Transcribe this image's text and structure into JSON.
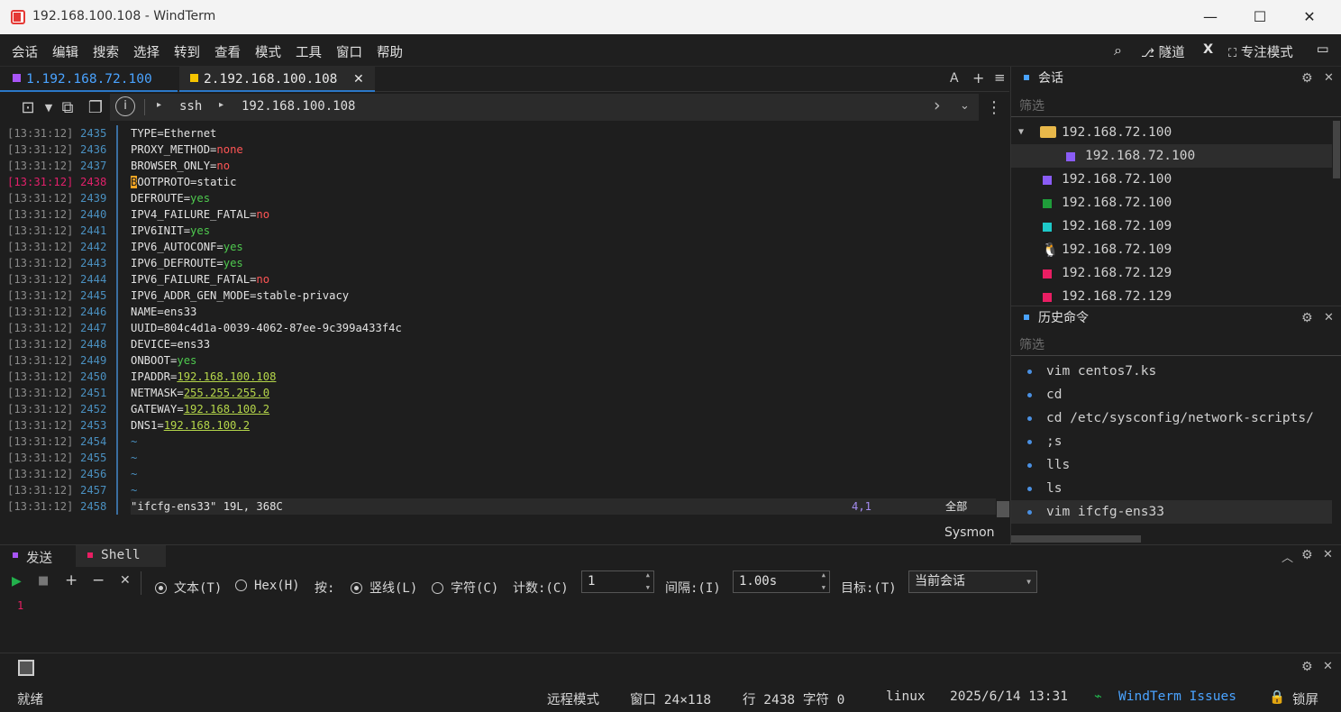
{
  "window": {
    "title": "192.168.100.108 - WindTerm"
  },
  "menu": [
    "会话",
    "编辑",
    "搜索",
    "选择",
    "转到",
    "查看",
    "模式",
    "工具",
    "窗口",
    "帮助"
  ],
  "menu_right": {
    "tunnel": "隧道",
    "x": "X",
    "focus": "专注模式"
  },
  "tabs": [
    {
      "label": "1.192.168.72.100",
      "color": "#a855f7",
      "active": false
    },
    {
      "label": "2.192.168.100.108",
      "color": "#f5c400",
      "active": true
    }
  ],
  "tab_actions": {
    "font": "A",
    "add": "+",
    "menu": "≡"
  },
  "address": {
    "protocol": "ssh",
    "host": "192.168.100.108"
  },
  "terminal": {
    "lines": [
      {
        "ts": "[13:31:12]",
        "num": "2435",
        "key": "TYPE",
        "val": "Ethernet",
        "vtype": "plain"
      },
      {
        "ts": "[13:31:12]",
        "num": "2436",
        "key": "PROXY_METHOD",
        "val": "none",
        "vtype": "red"
      },
      {
        "ts": "[13:31:12]",
        "num": "2437",
        "key": "BROWSER_ONLY",
        "val": "no",
        "vtype": "red"
      },
      {
        "ts": "[13:31:12]",
        "num": "2438",
        "key": "BOOTPROTO",
        "val": "static",
        "vtype": "plain",
        "current": true
      },
      {
        "ts": "[13:31:12]",
        "num": "2439",
        "key": "DEFROUTE",
        "val": "yes",
        "vtype": "grn"
      },
      {
        "ts": "[13:31:12]",
        "num": "2440",
        "key": "IPV4_FAILURE_FATAL",
        "val": "no",
        "vtype": "red"
      },
      {
        "ts": "[13:31:12]",
        "num": "2441",
        "key": "IPV6INIT",
        "val": "yes",
        "vtype": "grn"
      },
      {
        "ts": "[13:31:12]",
        "num": "2442",
        "key": "IPV6_AUTOCONF",
        "val": "yes",
        "vtype": "grn"
      },
      {
        "ts": "[13:31:12]",
        "num": "2443",
        "key": "IPV6_DEFROUTE",
        "val": "yes",
        "vtype": "grn"
      },
      {
        "ts": "[13:31:12]",
        "num": "2444",
        "key": "IPV6_FAILURE_FATAL",
        "val": "no",
        "vtype": "red"
      },
      {
        "ts": "[13:31:12]",
        "num": "2445",
        "key": "IPV6_ADDR_GEN_MODE",
        "val": "stable-privacy",
        "vtype": "plain"
      },
      {
        "ts": "[13:31:12]",
        "num": "2446",
        "key": "NAME",
        "val": "ens33",
        "vtype": "plain"
      },
      {
        "ts": "[13:31:12]",
        "num": "2447",
        "key": "UUID",
        "val": "804c4d1a-0039-4062-87ee-9c399a433f4c",
        "vtype": "plain"
      },
      {
        "ts": "[13:31:12]",
        "num": "2448",
        "key": "DEVICE",
        "val": "ens33",
        "vtype": "plain"
      },
      {
        "ts": "[13:31:12]",
        "num": "2449",
        "key": "ONBOOT",
        "val": "yes",
        "vtype": "grn"
      },
      {
        "ts": "[13:31:12]",
        "num": "2450",
        "key": "IPADDR",
        "val": "192.168.100.108",
        "vtype": "ip"
      },
      {
        "ts": "[13:31:12]",
        "num": "2451",
        "key": "NETMASK",
        "val": "255.255.255.0",
        "vtype": "ip"
      },
      {
        "ts": "[13:31:12]",
        "num": "2452",
        "key": "GATEWAY",
        "val": "192.168.100.2",
        "vtype": "ip"
      },
      {
        "ts": "[13:31:12]",
        "num": "2453",
        "key": "DNS1",
        "val": "192.168.100.2",
        "vtype": "ip"
      },
      {
        "ts": "[13:31:12]",
        "num": "2454",
        "key": "~",
        "val": "",
        "vtype": "tilde"
      },
      {
        "ts": "[13:31:12]",
        "num": "2455",
        "key": "~",
        "val": "",
        "vtype": "tilde"
      },
      {
        "ts": "[13:31:12]",
        "num": "2456",
        "key": "~",
        "val": "",
        "vtype": "tilde"
      },
      {
        "ts": "[13:31:12]",
        "num": "2457",
        "key": "~",
        "val": "",
        "vtype": "tilde"
      }
    ],
    "status_line": {
      "ts": "[13:31:12]",
      "num": "2458",
      "file": "\"ifcfg-ens33\" 19L, 368C",
      "pos": "4,1",
      "scope": "全部"
    },
    "sysmon": "Sysmon"
  },
  "sessions_panel": {
    "title": "会话",
    "filter": "筛选",
    "items": [
      {
        "label": "192.168.72.100",
        "icon": "folder-icon",
        "color": "#e8b84a",
        "level": 0,
        "expanded": true
      },
      {
        "label": "192.168.72.100",
        "icon": "square-icon",
        "color": "#8a5cf6",
        "level": 1,
        "selected": true
      },
      {
        "label": "192.168.72.100",
        "icon": "square-icon",
        "color": "#8a5cf6",
        "level": 0
      },
      {
        "label": "192.168.72.100",
        "icon": "square-icon",
        "color": "#1f9d3a",
        "level": 0
      },
      {
        "label": "192.168.72.109",
        "icon": "square-icon",
        "color": "#1ec8c8",
        "level": 0
      },
      {
        "label": "192.168.72.109",
        "icon": "linux-icon",
        "color": "#f0f0f0",
        "level": 0
      },
      {
        "label": "192.168.72.129",
        "icon": "square-icon",
        "color": "#e91e63",
        "level": 0
      },
      {
        "label": "192.168.72.129",
        "icon": "square-icon",
        "color": "#e91e63",
        "level": 0
      }
    ]
  },
  "history_panel": {
    "title": "历史命令",
    "filter": "筛选",
    "items": [
      "vim centos7.ks",
      "cd",
      "cd /etc/sysconfig/network-scripts/",
      ";s",
      "lls",
      "ls",
      "vim ifcfg-ens33"
    ]
  },
  "send_panel": {
    "tabs": [
      {
        "label": "发送",
        "color": "#a855f7"
      },
      {
        "label": "Shell",
        "color": "#e91e63"
      }
    ],
    "mode_text": "文本(T)",
    "mode_hex": "Hex(H)",
    "by_label": "按:",
    "by_line": "竖线(L)",
    "by_char": "字符(C)",
    "count_label": "计数:(C)",
    "count_value": "1",
    "interval_label": "间隔:(I)",
    "interval_value": "1.00s",
    "target_label": "目标:(T)",
    "target_value": "当前会话",
    "editor_line": "1"
  },
  "status": {
    "ready": "就绪",
    "mode": "远程模式",
    "window_size": "窗口 24×118",
    "cursor": "行 2438 字符 0",
    "os": "linux",
    "datetime": "2025/6/14 13:31",
    "issues": "WindTerm Issues",
    "lock": "锁屏"
  }
}
